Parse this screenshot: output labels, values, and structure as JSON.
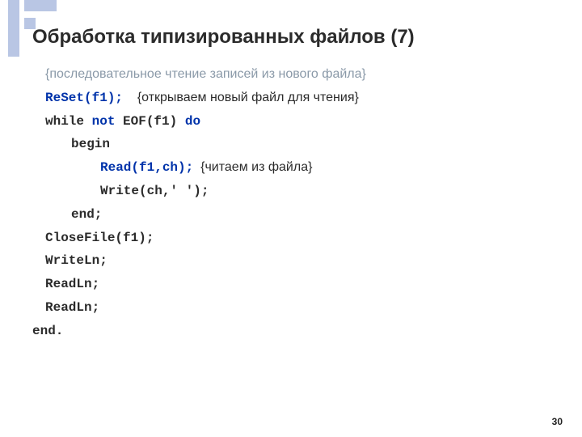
{
  "title": "Обработка типизированных файлов (7)",
  "topComment": "{последовательное чтение записей из нового файла}",
  "code": {
    "l1_kw": "ReSet(f1);",
    "l1_cm": "{открываем новый файл для чтения}",
    "l2_a": "while ",
    "l2_not": "not",
    "l2_b": " EOF(f1) ",
    "l2_do": "do",
    "l3": "begin",
    "l4_kw": "Read(f1,ch);",
    "l4_cm": "{читаем из файла}",
    "l5": "Write(ch,' ');",
    "l6": "end;",
    "l7": "CloseFile(f1);",
    "l8": "WriteLn;",
    "l9": "ReadLn;",
    "l10": "ReadLn;",
    "l11": "end."
  },
  "pageNumber": "30"
}
